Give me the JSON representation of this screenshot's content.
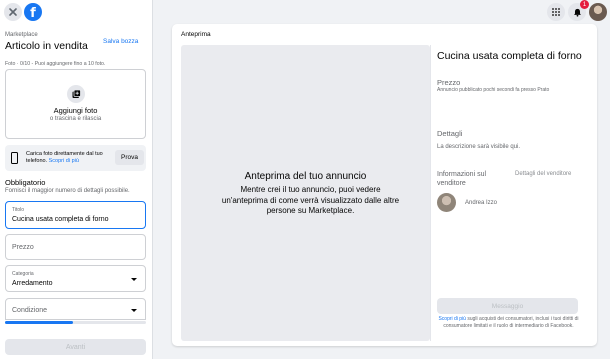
{
  "sidebar": {
    "breadcrumb": "Marketplace",
    "title": "Articolo in vendita",
    "save_draft": "Salva bozza",
    "photo_info": "Foto · 0/10 - Puoi aggiungere fino a 10 foto.",
    "add_photo": {
      "label": "Aggiungi foto",
      "sub": "o trascina e rilascia"
    },
    "phone_upload": {
      "text": "Carica foto direttamente dal tuo telefono.",
      "link": "Scopri di più",
      "button": "Prova"
    },
    "required": {
      "title": "Obbligatorio",
      "subtitle": "Fornisci il maggior numero di dettagli possibile."
    },
    "fields": {
      "title": {
        "label": "Titolo",
        "value": "Cucina usata completa di forno"
      },
      "price": {
        "placeholder": "Prezzo"
      },
      "category": {
        "label": "Categoria",
        "value": "Arredamento"
      },
      "condition": {
        "placeholder": "Condizione"
      }
    },
    "progress": 0.48,
    "next_button": "Avanti"
  },
  "topnav": {
    "notifications_count": "1"
  },
  "preview": {
    "header": "Anteprima",
    "pane_title": "Anteprima del tuo annuncio",
    "pane_text": "Mentre crei il tuo annuncio, puoi vedere un'anteprima di come verrà visualizzato dalle altre persone su Marketplace.",
    "listing_title": "Cucina usata completa di forno",
    "price": "Prezzo",
    "meta": "Annuncio pubblicato pochi secondi fa presso Prato",
    "details_heading": "Dettagli",
    "description": "La descrizione sarà visibile qui.",
    "seller_heading": "Informazioni sul venditore",
    "seller_link": "Dettagli del venditore",
    "seller_name": "Andrea Izzo",
    "message_button": "Messaggio",
    "legal_link": "Scopri di più",
    "legal_text": "sugli acquisti dei consumatori, inclusi i tuoi diritti di consumatore limitati e il ruolo di intermediario di Facebook."
  },
  "colors": {
    "accent": "#1877f2",
    "badge": "#e41e3f"
  }
}
